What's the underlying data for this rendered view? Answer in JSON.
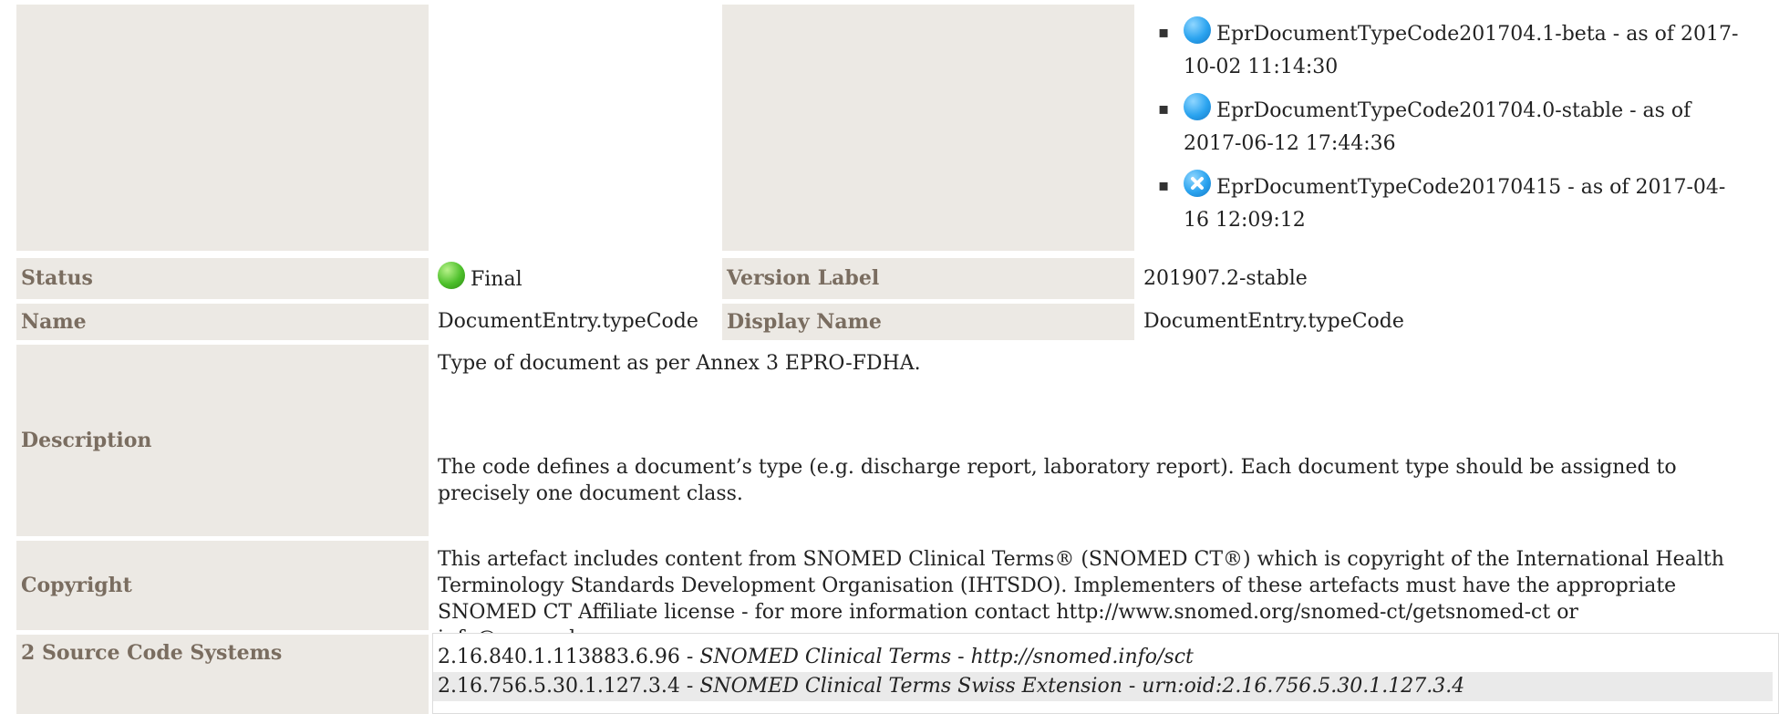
{
  "versions": [
    {
      "icon": "blue-status-icon",
      "name": "EprDocumentTypeCode201704.1-beta",
      "as_of": " - as of 2017-10-02 11:14:30"
    },
    {
      "icon": "blue-status-icon",
      "name": "EprDocumentTypeCode201704.0-stable",
      "as_of": " - as of 2017-06-12 17:44:36"
    },
    {
      "icon": "cancelled-status-icon",
      "name": "EprDocumentTypeCode20170415",
      "as_of": " - as of 2017-04-16 12:09:12"
    }
  ],
  "status": {
    "label": "Status",
    "value": "Final"
  },
  "version_label": {
    "label": "Version Label",
    "value": "201907.2-stable"
  },
  "name": {
    "label": "Name",
    "value": "DocumentEntry.typeCode"
  },
  "display_name": {
    "label": "Display Name",
    "value": "DocumentEntry.typeCode"
  },
  "description": {
    "label": "Description",
    "para1": "Type of document as per Annex 3 EPRO-FDHA.",
    "para2": "The code defines a document’s type (e.g. discharge report, laboratory report). Each document type should be assigned to precisely one document class."
  },
  "copyright": {
    "label": "Copyright",
    "text": "This artefact includes content from SNOMED Clinical Terms® (SNOMED CT®) which is copyright of the International Health Terminology Standards Development Organisation (IHTSDO). Implementers of these artefacts must have the appropriate SNOMED CT Affiliate license - for more information contact http://www.snomed.org/snomed-ct/getsnomed-ct or info@snomed.org."
  },
  "source_code_systems": {
    "label": "2 Source Code Systems",
    "rows": [
      {
        "oid": "2.16.840.1.113883.6.96",
        "sep1": " - ",
        "name": "SNOMED Clinical Terms",
        "sep2": " - ",
        "uri": "http://snomed.info/sct"
      },
      {
        "oid": "2.16.756.5.30.1.127.3.4",
        "sep1": " - ",
        "name": "SNOMED Clinical Terms Swiss Extension",
        "sep2": " - ",
        "uri": "urn:oid:2.16.756.5.30.1.127.3.4"
      }
    ]
  }
}
